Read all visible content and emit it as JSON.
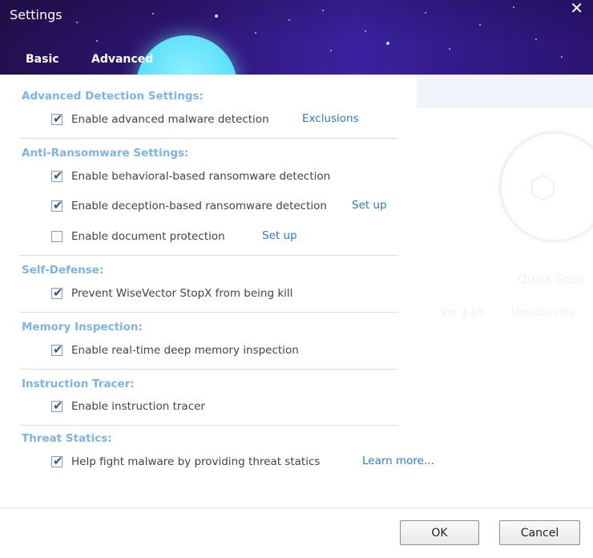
{
  "window": {
    "title": "Settings",
    "close_glyph": "✕"
  },
  "tabs": [
    {
      "label": "Basic"
    },
    {
      "label": "Advanced"
    }
  ],
  "active_tab": "Advanced",
  "background": {
    "quick_scan": "Quick Scan",
    "version": "Ver 2.05",
    "subscribe": "Unsubscribe"
  },
  "sections": {
    "advanced_detection": {
      "title": "Advanced Detection Settings:",
      "options": [
        {
          "label": "Enable advanced malware detection",
          "checked": true,
          "link": "Exclusions"
        }
      ]
    },
    "anti_ransomware": {
      "title": "Anti-Ransomware Settings:",
      "options": [
        {
          "label": "Enable behavioral-based ransomware detection",
          "checked": true
        },
        {
          "label": "Enable deception-based ransomware detection",
          "checked": true,
          "link": "Set up"
        },
        {
          "label": "Enable document protection",
          "checked": false,
          "link": "Set up"
        }
      ]
    },
    "self_defense": {
      "title": "Self-Defense:",
      "options": [
        {
          "label": "Prevent WiseVector StopX from being kill",
          "checked": true
        }
      ]
    },
    "memory_inspection": {
      "title": "Memory Inspection:",
      "options": [
        {
          "label": "Enable real-time deep memory inspection",
          "checked": true
        }
      ]
    },
    "instruction_tracer": {
      "title": "Instruction Tracer:",
      "options": [
        {
          "label": "Enable instruction tracer",
          "checked": true
        }
      ]
    },
    "threat_statics": {
      "title": "Threat Statics:",
      "options": [
        {
          "label": "Help fight malware by providing threat statics",
          "checked": true,
          "link": "Learn more..."
        }
      ]
    }
  },
  "check_glyph": "✔",
  "buttons": {
    "ok": "OK",
    "cancel": "Cancel"
  },
  "colors": {
    "section_title": "#7fb3e1",
    "link": "#2f7bc0",
    "header_dark": "#23104f",
    "planet": "#5fe0fb"
  }
}
